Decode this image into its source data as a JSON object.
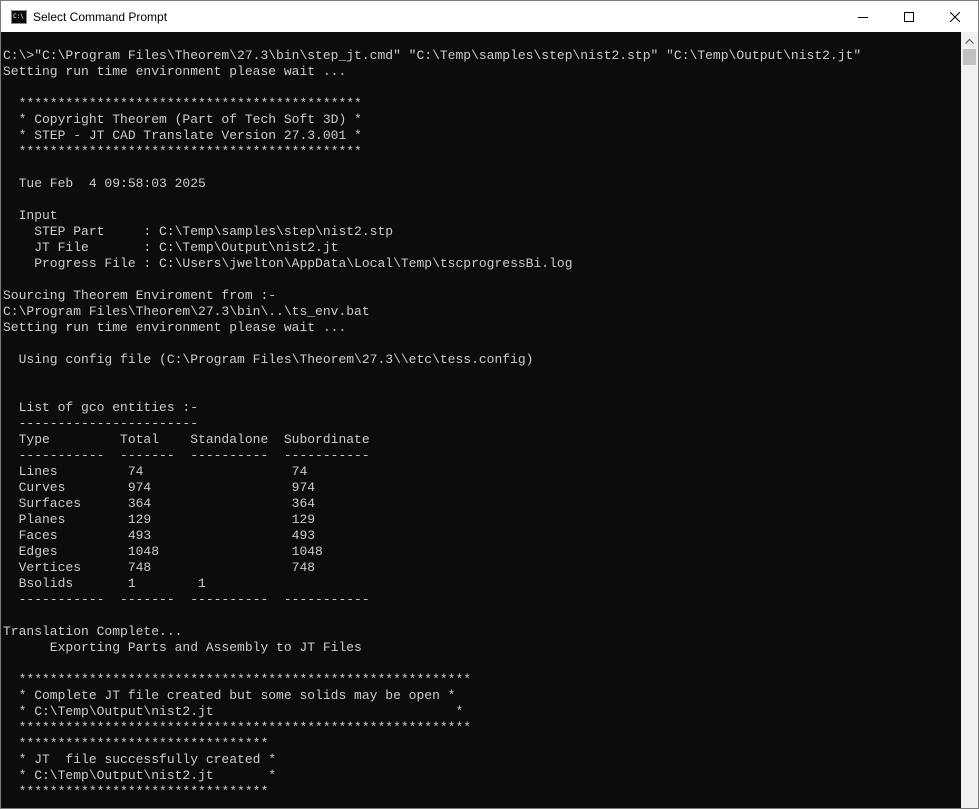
{
  "window": {
    "title": "Select Command Prompt",
    "icon_label": "C:\\",
    "controls": {
      "minimize": "minimize-icon",
      "maximize": "maximize-icon",
      "close": "close-icon"
    }
  },
  "console": {
    "lines": [
      "C:\\>\"C:\\Program Files\\Theorem\\27.3\\bin\\step_jt.cmd\" \"C:\\Temp\\samples\\step\\nist2.stp\" \"C:\\Temp\\Output\\nist2.jt\"",
      "Setting run time environment please wait ...",
      "",
      "  ********************************************",
      "  * Copyright Theorem (Part of Tech Soft 3D) *",
      "  * STEP - JT CAD Translate Version 27.3.001 *",
      "  ********************************************",
      "",
      "  Tue Feb  4 09:58:03 2025",
      "",
      "  Input",
      "    STEP Part     : C:\\Temp\\samples\\step\\nist2.stp",
      "    JT File       : C:\\Temp\\Output\\nist2.jt",
      "    Progress File : C:\\Users\\jwelton\\AppData\\Local\\Temp\\tscprogressBi.log",
      "",
      "Sourcing Theorem Enviroment from :-",
      "C:\\Program Files\\Theorem\\27.3\\bin\\..\\ts_env.bat",
      "Setting run time environment please wait ...",
      "",
      "  Using config file (C:\\Program Files\\Theorem\\27.3\\\\etc\\tess.config)",
      "",
      "",
      "  List of gco entities :-",
      "  -----------------------",
      "  Type         Total    Standalone  Subordinate",
      "  -----------  -------  ----------  -----------",
      "  Lines         74                   74",
      "  Curves        974                  974",
      "  Surfaces      364                  364",
      "  Planes        129                  129",
      "  Faces         493                  493",
      "  Edges         1048                 1048",
      "  Vertices      748                  748",
      "  Bsolids       1        1",
      "  -----------  -------  ----------  -----------",
      "",
      "Translation Complete...",
      "      Exporting Parts and Assembly to JT Files",
      "",
      "  **********************************************************",
      "  * Complete JT file created but some solids may be open *",
      "  * C:\\Temp\\Output\\nist2.jt                               *",
      "  **********************************************************",
      "  ********************************",
      "  * JT  file successfully created *",
      "  * C:\\Temp\\Output\\nist2.jt       *",
      "  ********************************"
    ]
  }
}
